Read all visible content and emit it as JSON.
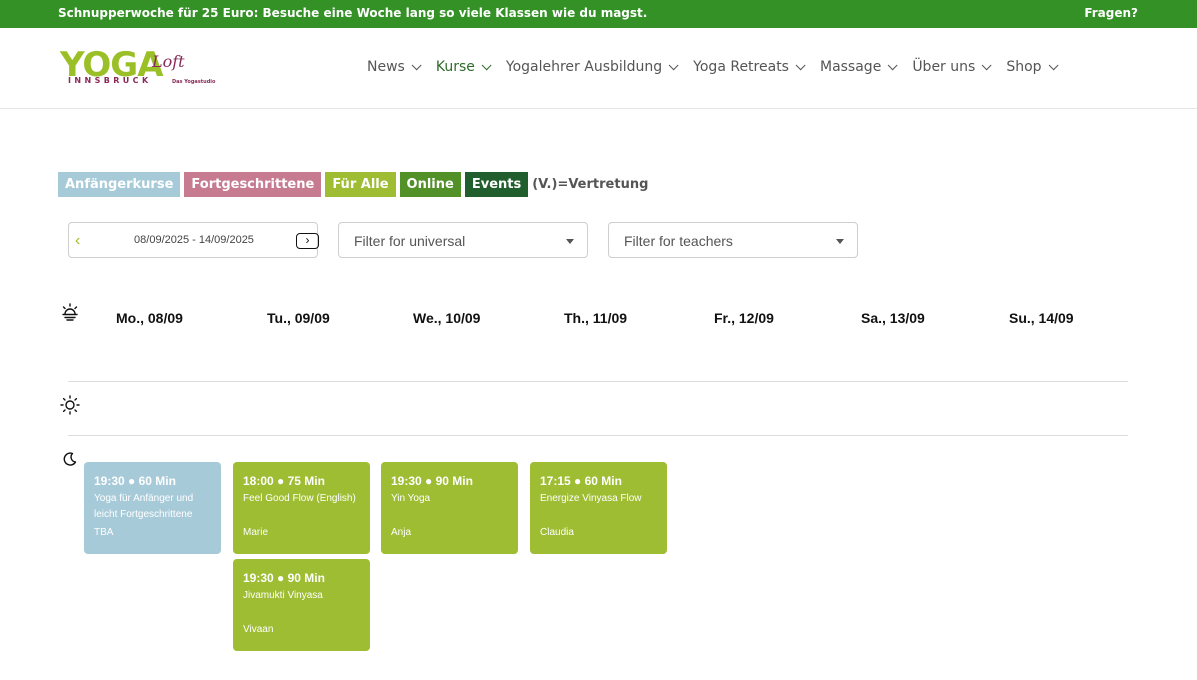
{
  "topbar": {
    "promo": "Schnupperwoche für 25 Euro: Besuche eine Woche lang so viele Klassen wie du magst.",
    "help": "Fragen?"
  },
  "logo": {
    "yoga": "YOGA",
    "loft": "Loft",
    "city": "INNSBRUCK",
    "sub": "Das Yogastudio"
  },
  "nav": [
    {
      "label": "News"
    },
    {
      "label": "Kurse"
    },
    {
      "label": "Yogalehrer Ausbildung"
    },
    {
      "label": "Yoga Retreats"
    },
    {
      "label": "Massage"
    },
    {
      "label": "Über uns"
    },
    {
      "label": "Shop"
    }
  ],
  "legend": {
    "tags": [
      {
        "label": "Anfängerkurse",
        "color": "#a7cad9"
      },
      {
        "label": "Fortgeschrittene",
        "color": "#c77b91"
      },
      {
        "label": "Für Alle",
        "color": "#9ebd33"
      },
      {
        "label": "Online",
        "color": "#519128"
      },
      {
        "label": "Events",
        "color": "#215e2d"
      }
    ],
    "note": "(V.)=Vertretung"
  },
  "filters": {
    "date_range": "08/09/2025 - 14/09/2025",
    "universal_placeholder": "Filter for universal",
    "teachers_placeholder": "Filter for teachers"
  },
  "days": [
    {
      "label": "Mo., 08/09"
    },
    {
      "label": "Tu., 09/09"
    },
    {
      "label": "We., 10/09"
    },
    {
      "label": "Th., 11/09"
    },
    {
      "label": "Fr., 12/09"
    },
    {
      "label": "Sa., 13/09"
    },
    {
      "label": "Su., 14/09"
    }
  ],
  "sections": {
    "morning_icon": "sunrise-icon",
    "day_icon": "sun-icon",
    "evening_icon": "moon-icon"
  },
  "classes": [
    {
      "time": "19:30 ● 60 Min",
      "title": "Yoga für Anfänger und leicht Fortgeschrittene",
      "teacher": "TBA",
      "color": "#a7cad9"
    },
    {
      "time": "18:00 ● 75 Min",
      "title": "Feel Good Flow (English)",
      "teacher": "Marie",
      "color": "#9ebd33"
    },
    {
      "time": "19:30 ● 90 Min",
      "title": "Jivamukti Vinyasa",
      "teacher": "Vivaan",
      "color": "#9ebd33"
    },
    {
      "time": "19:30 ● 90 Min",
      "title": "Yin Yoga",
      "teacher": "Anja",
      "color": "#9ebd33"
    },
    {
      "time": "17:15 ● 60 Min",
      "title": "Energize Vinyasa Flow",
      "teacher": "Claudia",
      "color": "#9ebd33"
    }
  ]
}
